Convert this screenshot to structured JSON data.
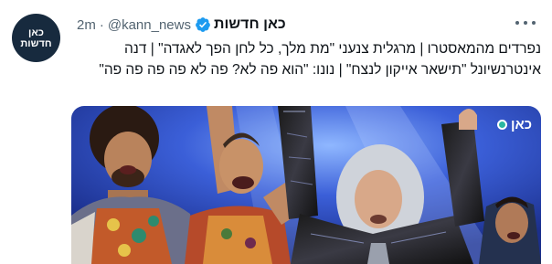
{
  "tweet": {
    "author_name": "כאן חדשות",
    "handle": "@kann_news",
    "separator": "·",
    "time": "2m",
    "verified_icon": "verified-badge-icon",
    "more_icon": "more-options-icon",
    "text": "נפרדים מהמאסטרו | מרגלית צנעני \"מת מלך, כל לחן הפך לאגדה\" | דנה אינטרנשיונל \"תישאר אייקון לנצח\" | נונו: \"הוא פה לא? פה לא פה פה פה פה\"",
    "avatar": {
      "line1": "כאן",
      "line2": "חדשות",
      "background": "#172a3e"
    },
    "media": {
      "watermark": "כאן",
      "description_icon": "photo-icon"
    },
    "colors": {
      "verified": "#1d9bf0",
      "muted": "#536471",
      "text": "#0f1419"
    }
  }
}
